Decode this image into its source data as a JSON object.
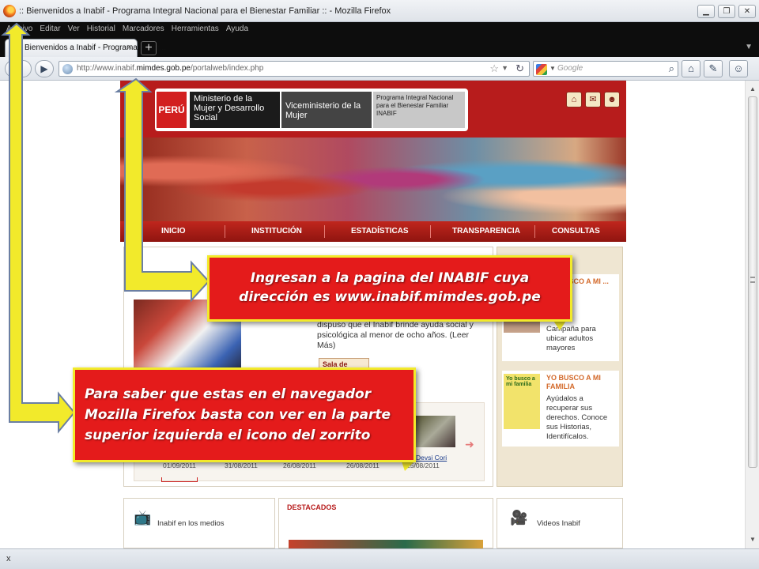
{
  "window": {
    "title": ":: Bienvenidos a Inabif - Programa Integral Nacional para el Bienestar Familiar :: - Mozilla Firefox",
    "controls": [
      "▁",
      "❐",
      "✕"
    ]
  },
  "menu": [
    "Archivo",
    "Editar",
    "Ver",
    "Historial",
    "Marcadores",
    "Herramientas",
    "Ayuda"
  ],
  "tab": {
    "label": "Bienvenidos a Inabif - Programa Integr...",
    "close": "×",
    "new": "+"
  },
  "navbar": {
    "url_prefix": "http://www.inabif.",
    "url_domain": "mimdes.gob.pe",
    "url_path": "/portalweb/index.php",
    "search_placeholder": "Google"
  },
  "site": {
    "logo_peru": "PERÚ",
    "logo_ministerio": "Ministerio de la Mujer y Desarrollo Social",
    "logo_vice": "Viceministerio de la Mujer",
    "logo_programa": "Programa Integral Nacional para el Bienestar Familiar INABIF",
    "nav": [
      "INICIO",
      "INSTITUCIÓN",
      "ESTADÍSTICAS",
      "TRANSPARENCIA",
      "CONSULTAS"
    ],
    "news_text": "dispuso que el Inabif brinde ayuda social y psicológica al menor de ocho años. (Leer Más)",
    "sala_prensa": "Sala de Prensa",
    "thumb_dates": [
      "01/09/2011",
      "31/08/2011",
      "26/08/2011",
      "26/08/2011",
      "25/08/2011"
    ],
    "thumb_caption": "Devsi Cori",
    "side1": {
      "title": "YO BUSCO A MI ... Adulto",
      "desc": "Campaña para ubicar adultos mayores"
    },
    "side2": {
      "title": "YO BUSCO A MI FAMILIA",
      "desc": "Ayúdalos a recuperar sus derechos. Conoce sus Historias, Identifícalos."
    },
    "side2_img_text": "Yo busco a mi familia",
    "bottom": {
      "medios": "Inabif en los medios",
      "destacados": "DESTACADOS",
      "videos": "Videos Inabif"
    }
  },
  "callouts": {
    "c1_line1": "Ingresan a la pagina del INABIF cuya",
    "c1_line2": "dirección es  www.inabif.mimdes.gob.pe",
    "c2": "Para saber que estas en el navegador Mozilla Firefox basta con ver en la parte superior izquierda el icono del zorrito"
  },
  "colors": {
    "arrow": "#f2ea2b",
    "callout": "#e41b1b",
    "brand_red": "#b71c1c"
  },
  "statusbar": {
    "close": "x"
  }
}
